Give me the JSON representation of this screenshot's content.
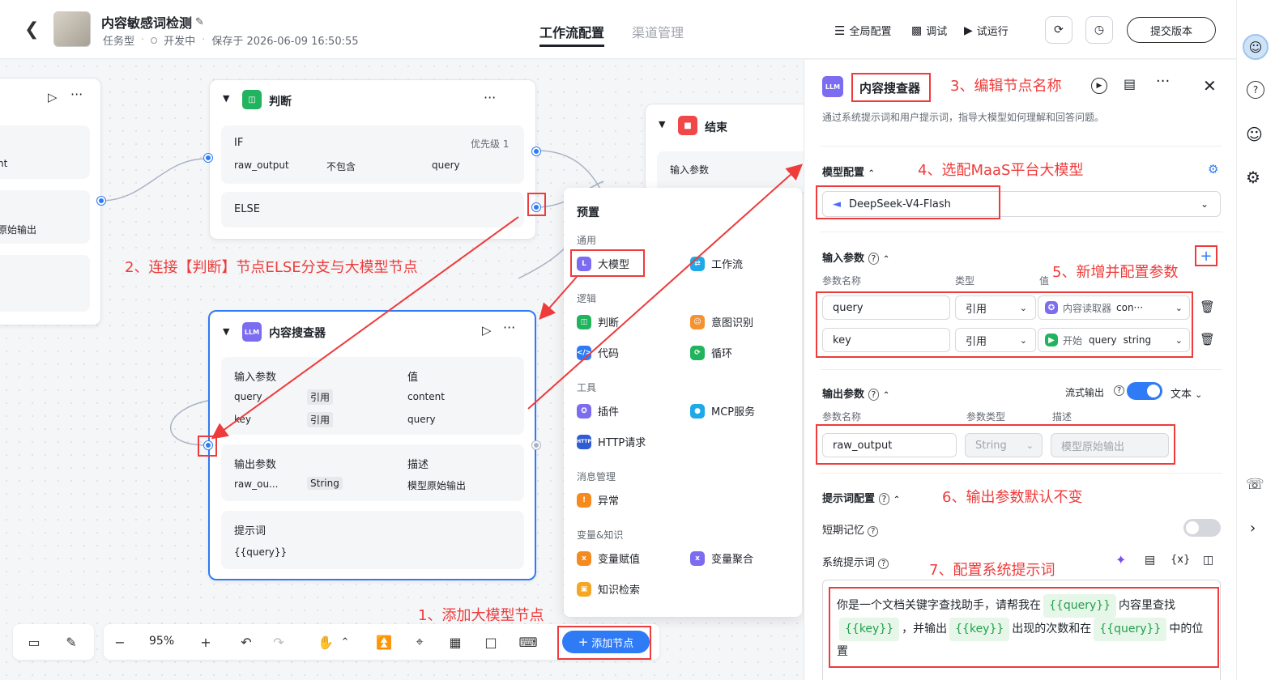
{
  "header": {
    "title": "内容敏感词检测",
    "type": "任务型",
    "status": "开发中",
    "saved": "保存于 2026-06-09 16:50:55",
    "tabs": [
      "工作流配置",
      "渠道管理"
    ],
    "actions": [
      "全局配置",
      "调试",
      "试运行"
    ],
    "submit": "提交版本"
  },
  "nodes": {
    "judge": {
      "title": "判断",
      "if": "IF",
      "priority": "优先级 1",
      "var": "raw_output",
      "op": "不包含",
      "val": "query",
      "else": "ELSE"
    },
    "end": {
      "title": "结束",
      "input": "输入参数"
    },
    "left": {
      "t1": "nt",
      "t2": "原始输出"
    },
    "llm": {
      "badge": "LLM",
      "title": "内容搜查器",
      "in_label": "输入参数",
      "val_label": "值",
      "rows": [
        {
          "name": "query",
          "type": "引用",
          "value": "content"
        },
        {
          "name": "key",
          "type": "引用",
          "value": "query"
        }
      ],
      "out_label": "输出参数",
      "desc_label": "描述",
      "out_name": "raw_ou...",
      "out_type": "String",
      "out_desc": "模型原始输出",
      "prompt_label": "提示词",
      "prompt": "{{query}}"
    }
  },
  "menu": {
    "title": "预置",
    "sections": {
      "general": "通用",
      "logic": "逻辑",
      "tools": "工具",
      "msg": "消息管理",
      "var": "变量&知识"
    },
    "items": {
      "llm": "大模型",
      "workflow": "工作流",
      "judge": "判断",
      "intent": "意图识别",
      "code": "代码",
      "loop": "循环",
      "plugin": "插件",
      "mcp": "MCP服务",
      "http": "HTTP请求",
      "exception": "异常",
      "assign": "变量赋值",
      "aggregate": "变量聚合",
      "knowledge": "知识检索"
    }
  },
  "toolbar": {
    "zoom": "95%",
    "add_node": "添加节点"
  },
  "panel": {
    "badge": "LLM",
    "title": "内容搜查器",
    "desc": "通过系统提示词和用户提示词，指导大模型如何理解和回答问题。",
    "model_section": "模型配置",
    "model": "DeepSeek-V4-Flash",
    "input_section": "输入参数",
    "cols": {
      "name": "参数名称",
      "type": "类型",
      "value": "值"
    },
    "inputs": [
      {
        "name": "query",
        "type": "引用",
        "src": "内容读取器",
        "ref": "con···"
      },
      {
        "name": "key",
        "type": "引用",
        "src": "开始",
        "ref": "query",
        "ref_type": "string"
      }
    ],
    "output_section": "输出参数",
    "stream": "流式输出",
    "format": "文本",
    "out_cols": {
      "name": "参数名称",
      "type": "参数类型",
      "desc": "描述"
    },
    "output": {
      "name": "raw_output",
      "type": "String",
      "desc": "模型原始输出"
    },
    "prompt_section": "提示词配置",
    "memory": "短期记忆",
    "sys_prompt": "系统提示词",
    "prompt_parts": {
      "p1": "你是一个文档关键字查找助手，请帮我在",
      "v1": "{{query}}",
      "p2": "内容里查找",
      "v2": "{{key}}",
      "p3": "，并输出",
      "v3": "{{key}}",
      "p4": "出现的次数和在",
      "v4": "{{query}}",
      "p5": "中的位置"
    }
  },
  "annotations": {
    "a1": "1、添加大模型节点",
    "a2": "2、连接【判断】节点ELSE分支与大模型节点",
    "a3": "3、编辑节点名称",
    "a4": "4、选配MaaS平台大模型",
    "a5": "5、新增并配置参数",
    "a6": "6、输出参数默认不变",
    "a7": "7、配置系统提示词"
  },
  "colors": {
    "accent": "#2f7bf5",
    "annotation": "#ee3b3b",
    "llm": "#7b6cf0",
    "judge": "#22b35e",
    "end": "#f04848"
  }
}
